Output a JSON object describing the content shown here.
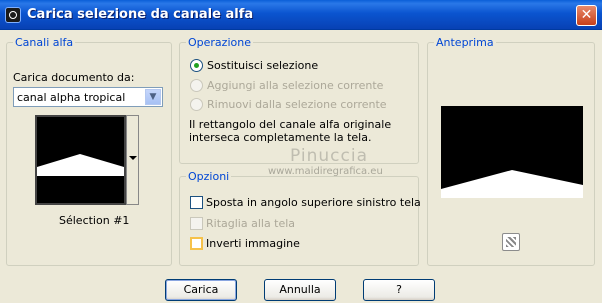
{
  "window": {
    "title": "Carica selezione da canale alfa",
    "close_symbol": "✕"
  },
  "canali": {
    "legend": "Canali alfa",
    "doc_label": "Carica documento da:",
    "doc_value": "canal alpha tropical",
    "thumb_caption": "Sélection #1"
  },
  "operazione": {
    "legend": "Operazione",
    "options": [
      {
        "label": "Sostituisci selezione",
        "selected": true,
        "enabled": true
      },
      {
        "label": "Aggiungi alla selezione corrente",
        "selected": false,
        "enabled": false
      },
      {
        "label": "Rimuovi dalla selezione corrente",
        "selected": false,
        "enabled": false
      }
    ],
    "desc_line1": "Il rettangolo del canale alfa originale",
    "desc_line2": "interseca completamente la tela."
  },
  "opzioni": {
    "legend": "Opzioni",
    "items": [
      {
        "label": "Sposta in angolo superiore sinistro tela",
        "checked": false,
        "enabled": true
      },
      {
        "label": "Ritaglia alla tela",
        "checked": false,
        "enabled": false
      },
      {
        "label": "Inverti immagine",
        "checked": false,
        "enabled": true
      }
    ]
  },
  "anteprima": {
    "legend": "Anteprima"
  },
  "watermark": {
    "line1": "Pinuccia",
    "line2": "www.maidiregrafica.eu"
  },
  "buttons": {
    "ok": "Carica",
    "cancel": "Annulla",
    "help": "?"
  }
}
